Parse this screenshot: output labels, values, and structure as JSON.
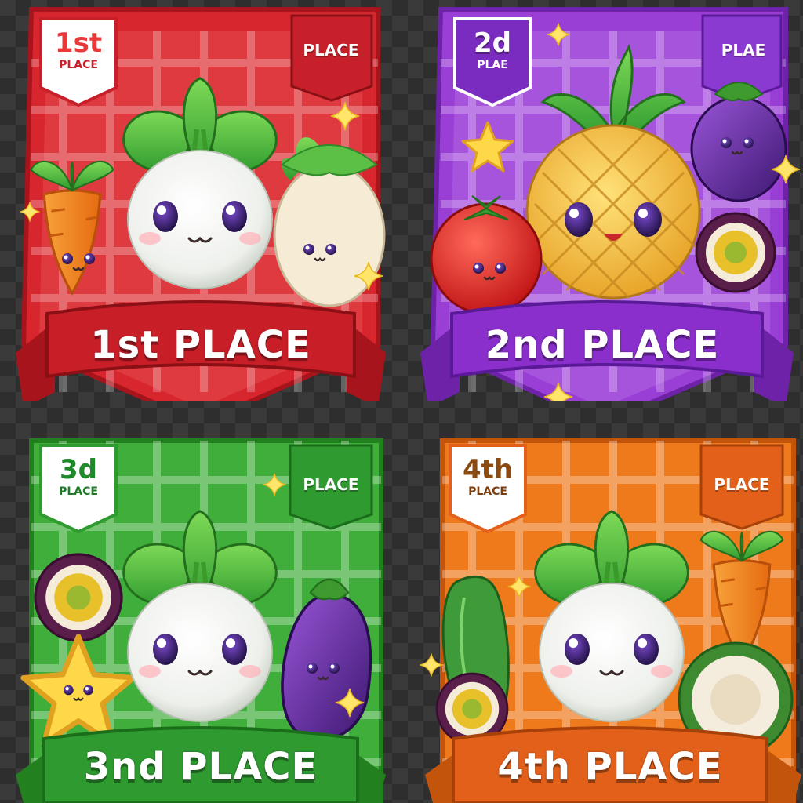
{
  "cards": [
    {
      "rank_badge": "1st",
      "badge_word": "PLACE",
      "tag": "PLACE",
      "banner": "1st PLACE",
      "theme": {
        "main": "#d8262e",
        "dark": "#a8141c",
        "light": "#f05a5e",
        "ribbon": "#c81e28"
      }
    },
    {
      "rank_badge": "2d",
      "badge_word": "PLAE",
      "tag": "PLAE",
      "banner": "2nd PLACE",
      "theme": {
        "main": "#9a3fd6",
        "dark": "#6e22a8",
        "light": "#c07ae8",
        "ribbon": "#8a2fcc"
      }
    },
    {
      "rank_badge": "3d",
      "badge_word": "PLACE",
      "tag": "PLACE",
      "banner": "3nd PLACE",
      "theme": {
        "main": "#3fae3a",
        "dark": "#23801f",
        "light": "#7ed26a",
        "ribbon": "#2e9a30"
      }
    },
    {
      "rank_badge": "4th",
      "badge_word": "PLACE",
      "tag": "PLACE",
      "banner": "4th PLACE",
      "theme": {
        "main": "#ee7a1c",
        "dark": "#c2540c",
        "light": "#f7a552",
        "ribbon": "#e2601a"
      }
    }
  ],
  "characters": {
    "card1": [
      "carrot-icon",
      "turnip-icon",
      "daikon-icon",
      "sparkle-icon"
    ],
    "card2": [
      "tomato-icon",
      "pineapple-icon",
      "eggplant-icon",
      "passion-fruit-icon",
      "star-icon"
    ],
    "card3": [
      "passion-fruit-icon",
      "star-icon",
      "turnip-icon",
      "eggplant-icon",
      "sparkle-icon"
    ],
    "card4": [
      "cucumber-icon",
      "passion-fruit-icon",
      "turnip-icon",
      "carrot-icon",
      "coconut-icon"
    ]
  }
}
